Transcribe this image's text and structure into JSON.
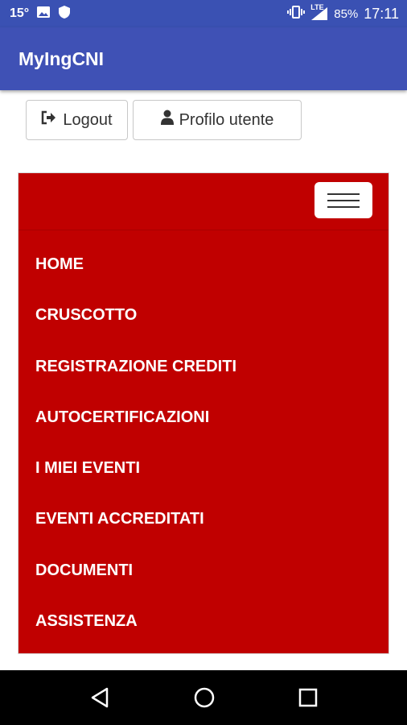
{
  "status_bar": {
    "temperature": "15°",
    "network": "LTE",
    "battery": "85%",
    "time": "17:11",
    "icons": [
      "image-icon",
      "shield-icon",
      "vibrate-icon",
      "signal-icon",
      "battery-icon"
    ]
  },
  "app_bar": {
    "title": "MyIngCNI"
  },
  "toolbar": {
    "logout_label": "Logout",
    "profile_label": "Profilo utente"
  },
  "menu": {
    "color": "#c00000",
    "items": [
      {
        "label": "HOME"
      },
      {
        "label": "CRUSCOTTO"
      },
      {
        "label": "REGISTRAZIONE CREDITI"
      },
      {
        "label": "AUTOCERTIFICAZIONI"
      },
      {
        "label": "I MIEI EVENTI"
      },
      {
        "label": "EVENTI ACCREDITATI"
      },
      {
        "label": "DOCUMENTI"
      },
      {
        "label": "ASSISTENZA"
      }
    ]
  },
  "system_nav": {
    "icons": [
      "back-icon",
      "home-icon",
      "recents-icon"
    ]
  },
  "colors": {
    "app_bar": "#3f51b5",
    "status_bar": "#3a51b3",
    "menu_background": "#c00000"
  }
}
